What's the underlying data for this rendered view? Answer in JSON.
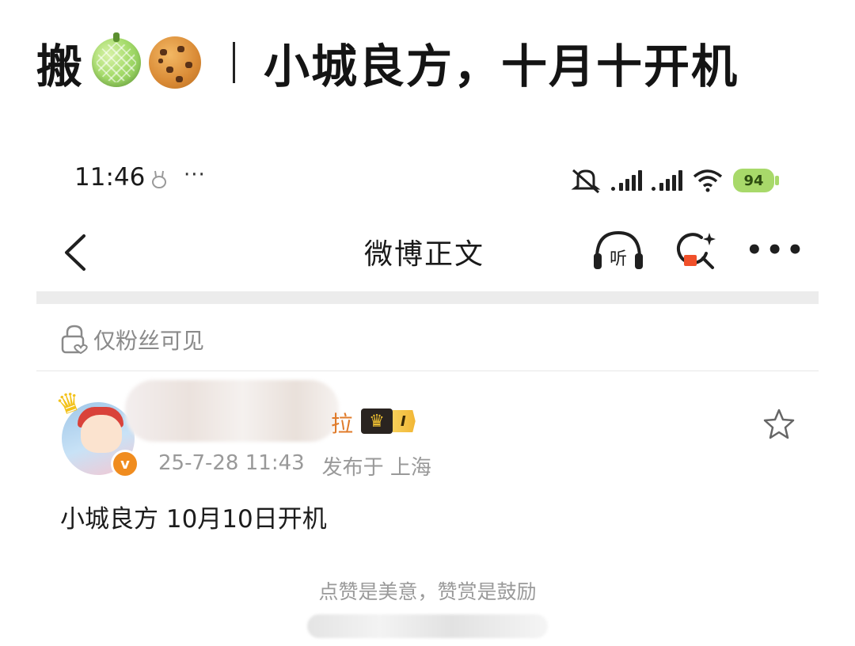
{
  "headline": {
    "prefix": "搬",
    "emojis": [
      "melon",
      "cookie"
    ],
    "separator": "|",
    "text": "小城良方，十月十开机"
  },
  "status_bar": {
    "time": "11:46",
    "small_icon": "rabbit-icon",
    "more": "···",
    "battery": "94"
  },
  "nav": {
    "title": "微博正文",
    "listen_label": "听"
  },
  "visibility": {
    "text": "仅粉丝可见"
  },
  "post": {
    "author_suffix": "拉",
    "vip_level": "I",
    "verified_mark": "v",
    "date": "25-7-28 11:43",
    "location": "发布于 上海",
    "content": "小城良方 10月10日开机"
  },
  "tip": "点赞是美意，赞赏是鼓励",
  "colors": {
    "accent_orange": "#f08c1f",
    "battery_green": "#a8d96a",
    "vip_gold": "#f2b634"
  }
}
